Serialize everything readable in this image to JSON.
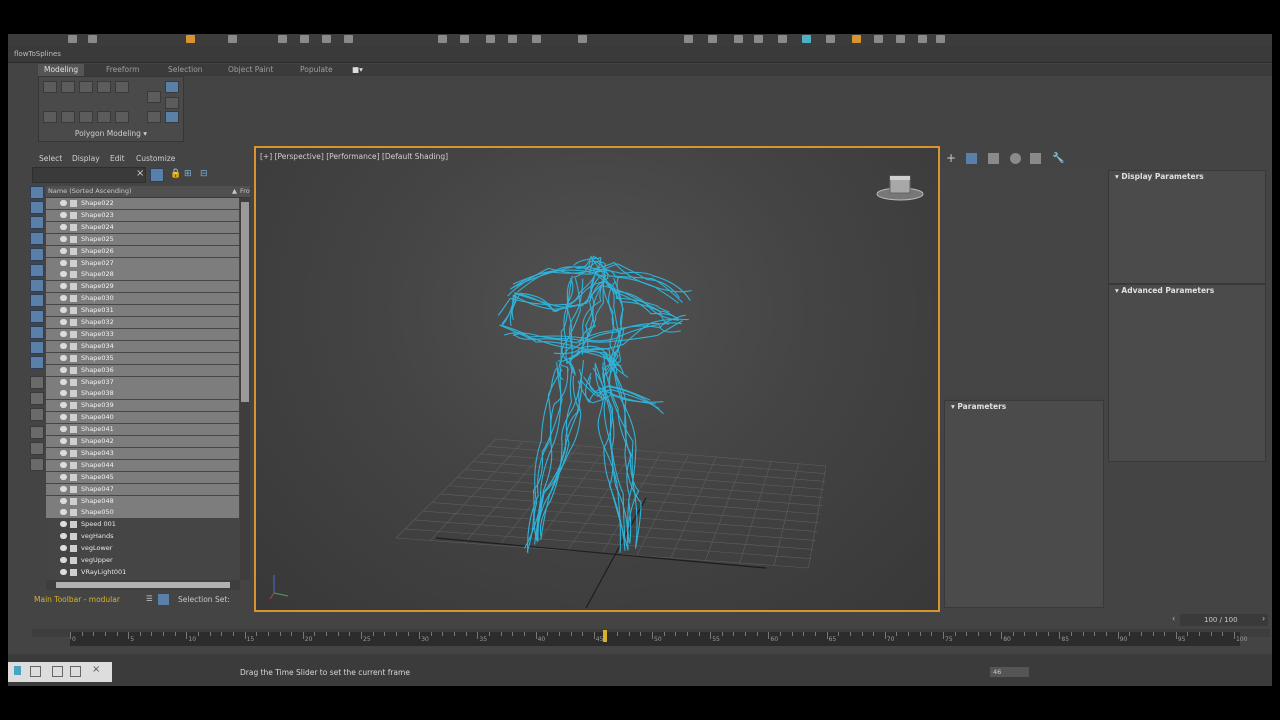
{
  "window": {
    "file_tab": "flowToSplines"
  },
  "ribbon": {
    "tabs": [
      "Modeling",
      "Freeform",
      "Selection",
      "Object Paint",
      "Populate"
    ],
    "panel_label": "Polygon Modeling"
  },
  "scene_explorer": {
    "menu": [
      "Select",
      "Display",
      "Edit",
      "Customize"
    ],
    "column_header": "Name (Sorted Ascending)",
    "column_header_right": "Fro",
    "items": [
      {
        "name": "Shape022",
        "selected": true
      },
      {
        "name": "Shape023",
        "selected": true
      },
      {
        "name": "Shape024",
        "selected": true
      },
      {
        "name": "Shape025",
        "selected": true
      },
      {
        "name": "Shape026",
        "selected": true
      },
      {
        "name": "Shape027",
        "selected": true
      },
      {
        "name": "Shape028",
        "selected": true
      },
      {
        "name": "Shape029",
        "selected": true
      },
      {
        "name": "Shape030",
        "selected": true
      },
      {
        "name": "Shape031",
        "selected": true
      },
      {
        "name": "Shape032",
        "selected": true
      },
      {
        "name": "Shape033",
        "selected": true
      },
      {
        "name": "Shape034",
        "selected": true
      },
      {
        "name": "Shape035",
        "selected": true
      },
      {
        "name": "Shape036",
        "selected": true
      },
      {
        "name": "Shape037",
        "selected": true
      },
      {
        "name": "Shape038",
        "selected": true
      },
      {
        "name": "Shape039",
        "selected": true
      },
      {
        "name": "Shape040",
        "selected": true
      },
      {
        "name": "Shape041",
        "selected": true
      },
      {
        "name": "Shape042",
        "selected": true
      },
      {
        "name": "Shape043",
        "selected": true
      },
      {
        "name": "Shape044",
        "selected": true
      },
      {
        "name": "Shape045",
        "selected": true
      },
      {
        "name": "Shape047",
        "selected": true
      },
      {
        "name": "Shape048",
        "selected": true
      },
      {
        "name": "Shape050",
        "selected": true
      },
      {
        "name": "Speed 001",
        "selected": false
      },
      {
        "name": "vegHands",
        "selected": false
      },
      {
        "name": "vegLower",
        "selected": false
      },
      {
        "name": "vegUpper",
        "selected": false
      },
      {
        "name": "VRayLight001",
        "selected": false
      }
    ]
  },
  "status_left": {
    "toolbar_label": "Main Toolbar - modular",
    "selection_set": "Selection Set:"
  },
  "viewport": {
    "label": "[+] [Perspective] [Performance] [Default Shading]"
  },
  "command_panel": {
    "display_params": "Display Parameters",
    "advanced_params": "Advanced Parameters",
    "parameters": "Parameters"
  },
  "timeline": {
    "frame_range": "100 / 100",
    "ticks": [
      "0",
      "5",
      "10",
      "15",
      "20",
      "25",
      "30",
      "35",
      "40",
      "45",
      "50",
      "55",
      "60",
      "65",
      "70",
      "75",
      "80",
      "85",
      "90",
      "95",
      "100"
    ],
    "current_frame": 46,
    "max_frame": 100
  },
  "status_bar": {
    "prompt": "Drag the Time Slider to set the current frame",
    "frame_field": "46"
  },
  "colors": {
    "accent": "#d89431",
    "wire": "#2fb8e0",
    "playhead": "#d8b227",
    "toolbar_label": "#d8b227"
  }
}
